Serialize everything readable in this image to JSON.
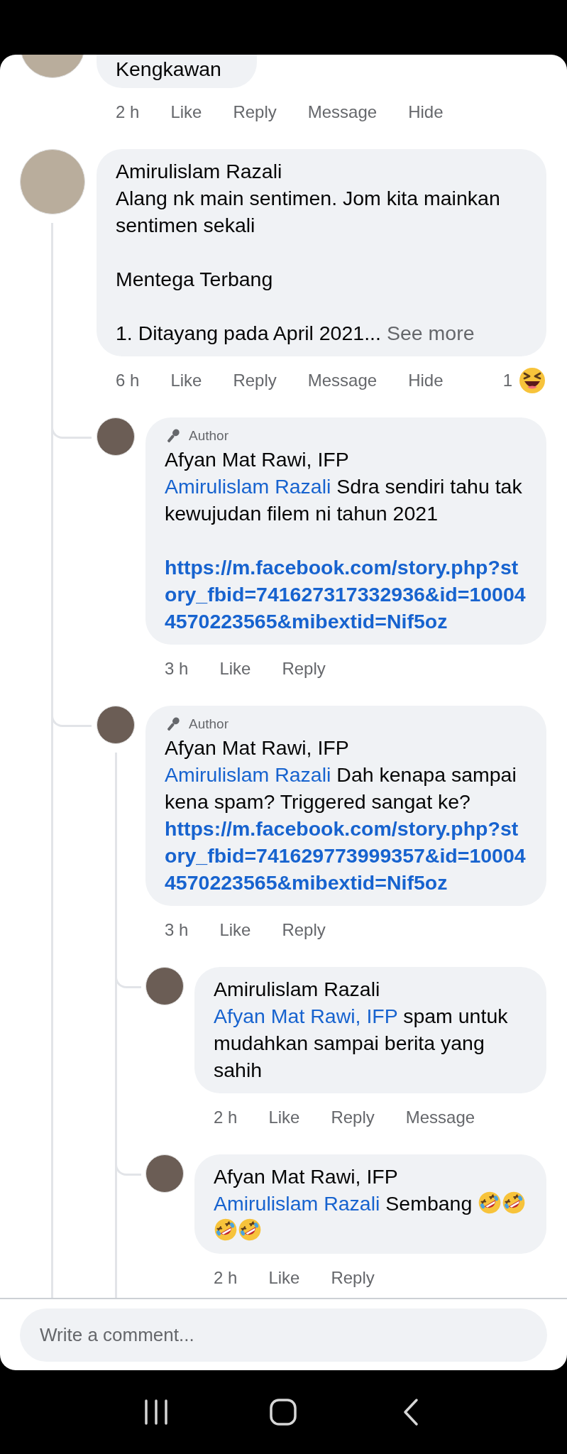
{
  "comments": [
    {
      "body": [
        {
          "kind": "text",
          "text": "Kengkawan"
        }
      ],
      "actions": {
        "time": "2 h",
        "buttons": [
          "Like",
          "Reply",
          "Message",
          "Hide"
        ]
      }
    },
    {
      "author": "Amirulislam Razali",
      "body": [
        {
          "kind": "text",
          "text": "Alang nk main sentimen. Jom kita mainkan sentimen sekali\n\nMentega Terbang\n\n1. Ditayang pada April 2021..."
        },
        {
          "kind": "more",
          "text": "See more"
        }
      ],
      "actions": {
        "time": "6 h",
        "buttons": [
          "Like",
          "Reply",
          "Message",
          "Hide"
        ]
      },
      "reaction": {
        "count": "1"
      },
      "replies": [
        {
          "author_badge": "Author",
          "author": "Afyan Mat Rawi, IFP",
          "body": [
            {
              "kind": "mention",
              "text": "Amirulislam Razali"
            },
            {
              "kind": "text",
              "text": " Sdra sendiri tahu tak kewujudan filem ni tahun 2021"
            },
            {
              "kind": "blank_line"
            },
            {
              "kind": "link",
              "text": "https://m.facebook.com/story.php?story_fbid=741627317332936&id=100044570223565&mibextid=Nif5oz"
            }
          ],
          "actions": {
            "time": "3 h",
            "buttons": [
              "Like",
              "Reply"
            ]
          }
        },
        {
          "author_badge": "Author",
          "author": "Afyan Mat Rawi, IFP",
          "body": [
            {
              "kind": "mention",
              "text": "Amirulislam Razali"
            },
            {
              "kind": "text",
              "text": " Dah kenapa sampai kena spam? Triggered sangat ke?"
            },
            {
              "kind": "link",
              "text": "https://m.facebook.com/story.php?story_fbid=741629773999357&id=100044570223565&mibextid=Nif5oz"
            }
          ],
          "actions": {
            "time": "3 h",
            "buttons": [
              "Like",
              "Reply"
            ]
          },
          "replies": [
            {
              "author": "Amirulislam Razali",
              "body": [
                {
                  "kind": "mention",
                  "text": "Afyan Mat Rawi, IFP"
                },
                {
                  "kind": "text",
                  "text": " spam untuk mudahkan sampai berita yang sahih"
                }
              ],
              "actions": {
                "time": "2 h",
                "buttons": [
                  "Like",
                  "Reply",
                  "Message"
                ]
              }
            },
            {
              "author": "Afyan Mat Rawi, IFP",
              "body": [
                {
                  "kind": "mention",
                  "text": "Amirulislam Razali"
                },
                {
                  "kind": "text",
                  "text": " Sembang "
                },
                {
                  "kind": "emoji"
                },
                {
                  "kind": "emoji"
                },
                {
                  "kind": "emoji"
                },
                {
                  "kind": "emoji"
                }
              ],
              "actions": {
                "time": "2 h",
                "buttons": [
                  "Like",
                  "Reply"
                ]
              }
            }
          ]
        }
      ]
    }
  ],
  "composer": {
    "placeholder": "Write a comment..."
  }
}
